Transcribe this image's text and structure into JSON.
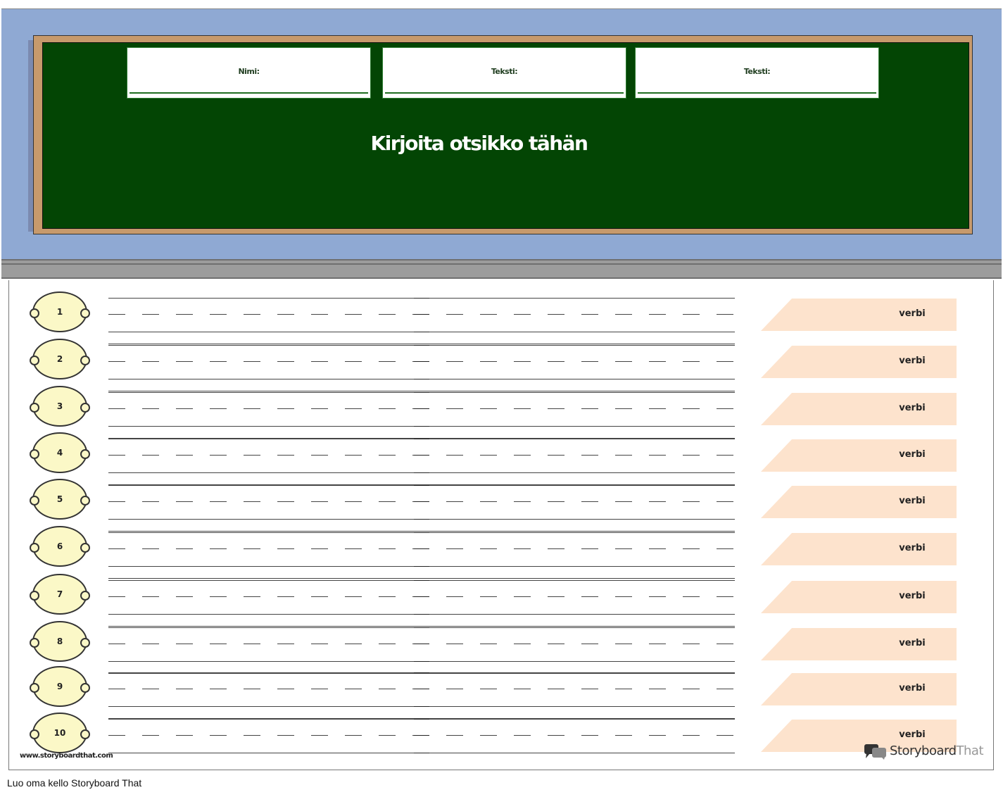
{
  "header": {
    "info_fields": [
      {
        "label": "Nimi:"
      },
      {
        "label": "Teksti:"
      },
      {
        "label": "Teksti:"
      }
    ],
    "title": "Kirjoita otsikko tähän"
  },
  "rows": [
    {
      "number": "1",
      "tag": "verbi"
    },
    {
      "number": "2",
      "tag": "verbi"
    },
    {
      "number": "3",
      "tag": "verbi"
    },
    {
      "number": "4",
      "tag": "verbi"
    },
    {
      "number": "5",
      "tag": "verbi"
    },
    {
      "number": "6",
      "tag": "verbi"
    },
    {
      "number": "7",
      "tag": "verbi"
    },
    {
      "number": "8",
      "tag": "verbi"
    },
    {
      "number": "9",
      "tag": "verbi"
    },
    {
      "number": "10",
      "tag": "verbi"
    }
  ],
  "footer": {
    "site_url": "www.storyboardthat.com",
    "brand_word1": "Storyboard",
    "brand_word2": "That",
    "brand_icon": "speech-bubbles-icon"
  },
  "caption": "Luo oma kello Storyboard That",
  "colors": {
    "wall": "#8fa9d3",
    "chalkboard": "#034504",
    "frame": "#c79a6c",
    "tray": "#9c9c9c",
    "badge": "#fbf8c7",
    "tag": "#fde3cd"
  }
}
